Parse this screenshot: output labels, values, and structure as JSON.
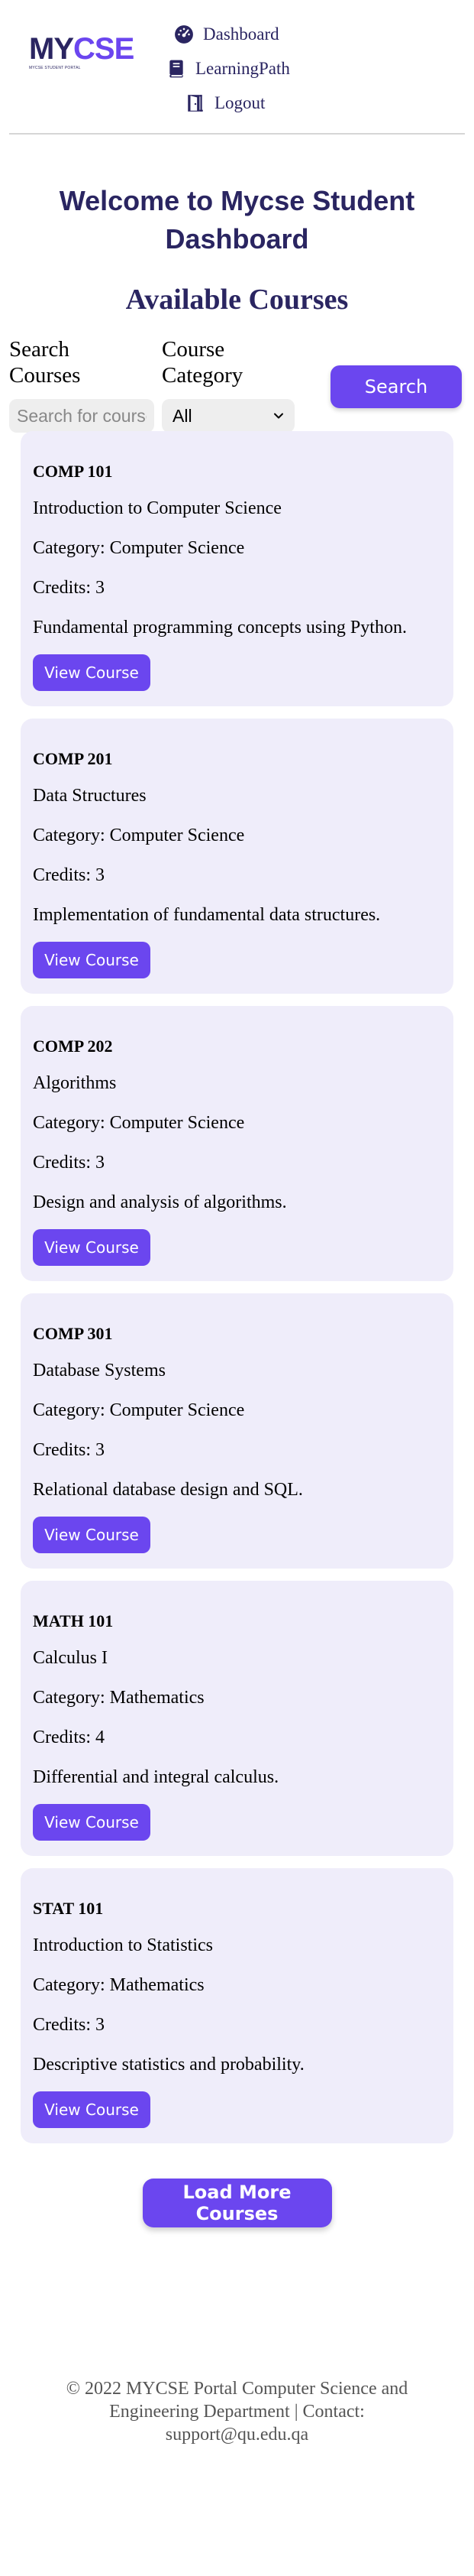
{
  "header": {
    "logo": {
      "my": "MY",
      "cse": "CSE",
      "tagline": "MYCSE STUDENT PORTAL"
    },
    "nav": [
      {
        "label": "Dashboard",
        "icon": "dashboard-gauge-icon"
      },
      {
        "label": "LearningPath",
        "icon": "book-icon"
      },
      {
        "label": "Logout",
        "icon": "logout-door-icon"
      }
    ]
  },
  "main": {
    "title": "Welcome to Mycse Student Dashboard",
    "section_title": "Available Courses",
    "filters": {
      "search_label": "Search Courses",
      "search_placeholder": "Search for courses",
      "category_label": "Course Category",
      "category_selected": "All",
      "search_button": "Search"
    },
    "courses": [
      {
        "code": "COMP 101",
        "name": "Introduction to Computer Science",
        "category": "Category: Computer Science",
        "credits": "Credits: 3",
        "description": "Fundamental programming concepts using Python.",
        "button": "View Course"
      },
      {
        "code": "COMP 201",
        "name": "Data Structures",
        "category": "Category: Computer Science",
        "credits": "Credits: 3",
        "description": "Implementation of fundamental data structures.",
        "button": "View Course"
      },
      {
        "code": "COMP 202",
        "name": "Algorithms",
        "category": "Category: Computer Science",
        "credits": "Credits: 3",
        "description": "Design and analysis of algorithms.",
        "button": "View Course"
      },
      {
        "code": "COMP 301",
        "name": "Database Systems",
        "category": "Category: Computer Science",
        "credits": "Credits: 3",
        "description": "Relational database design and SQL.",
        "button": "View Course"
      },
      {
        "code": "MATH 101",
        "name": "Calculus I",
        "category": "Category: Mathematics",
        "credits": "Credits: 4",
        "description": "Differential and integral calculus.",
        "button": "View Course"
      },
      {
        "code": "STAT 101",
        "name": "Introduction to Statistics",
        "category": "Category: Mathematics",
        "credits": "Credits: 3",
        "description": "Descriptive statistics and probability.",
        "button": "View Course"
      }
    ],
    "load_more": "Load More Courses"
  },
  "footer": {
    "text": "© 2022 MYCSE Portal Computer Science and Engineering Department | Contact: support@qu.edu.qa"
  },
  "colors": {
    "brand_dark": "#2a2561",
    "accent": "#6b46ef",
    "card_bg": "#efedfa"
  }
}
